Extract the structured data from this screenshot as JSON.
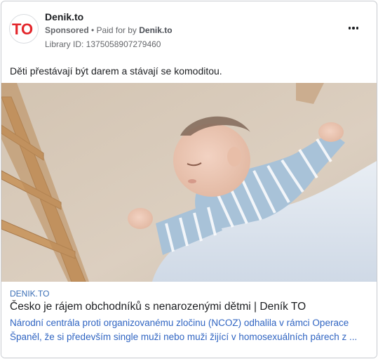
{
  "ad": {
    "page_name": "Denik.to",
    "sponsored_label": "Sponsored",
    "separator": " • ",
    "paid_for_prefix": "Paid for by ",
    "paid_for_by": "Denik.to",
    "library_id": "Library ID: 1375058907279460",
    "primary_text": "Děti přestávají být darem a stávají se komoditou.",
    "logo_text": "TO",
    "link": {
      "domain": "DENIK.TO",
      "title": "Česko je rájem obchodníků s nenarozenými dětmi | Deník TO",
      "description": "Národní centrála proti organizovanému zločinu (NCOZ) odhalila v rámci Operace Španěl, že si především single muži nebo muži žijící v homosexuálních párech z ..."
    }
  },
  "colors": {
    "brand_red": "#e3262b",
    "link_blue": "#2f64c2",
    "domain_blue": "#3b6fb6"
  },
  "icons": {
    "more": "more-options-icon"
  }
}
